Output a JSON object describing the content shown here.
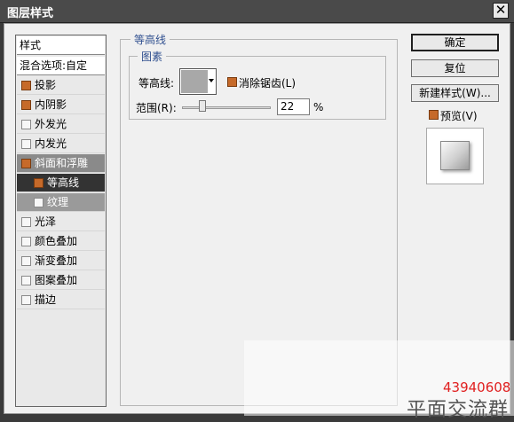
{
  "window": {
    "title": "图层样式",
    "close_label": "✕"
  },
  "style_list": {
    "header": "样式",
    "blend_options": "混合选项:自定",
    "items": [
      {
        "label": "投影",
        "checked": true
      },
      {
        "label": "内阴影",
        "checked": true
      },
      {
        "label": "外发光",
        "checked": false
      },
      {
        "label": "内发光",
        "checked": false
      },
      {
        "label": "斜面和浮雕",
        "checked": true
      },
      {
        "label": "等高线",
        "checked": true
      },
      {
        "label": "纹理",
        "checked": false
      },
      {
        "label": "光泽",
        "checked": false
      },
      {
        "label": "颜色叠加",
        "checked": false
      },
      {
        "label": "渐变叠加",
        "checked": false
      },
      {
        "label": "图案叠加",
        "checked": false
      },
      {
        "label": "描边",
        "checked": false
      }
    ]
  },
  "panel": {
    "group_title": "等高线",
    "subgroup_title": "图素",
    "contour_label": "等高线:",
    "antialias_label": "消除锯齿(L)",
    "antialias_checked": true,
    "range_label": "范围(R):",
    "range_value": "22",
    "range_unit": "%"
  },
  "buttons": {
    "ok": "确定",
    "reset": "复位",
    "new_style": "新建样式(W)...",
    "preview_label": "预览(V)",
    "preview_checked": true
  },
  "watermark": {
    "number": "43940608",
    "text": "平面交流群"
  },
  "colors": {
    "accent_checkbox": "#c66a2a",
    "selected_row": "#333333",
    "group_title": "#2f4f8f"
  }
}
